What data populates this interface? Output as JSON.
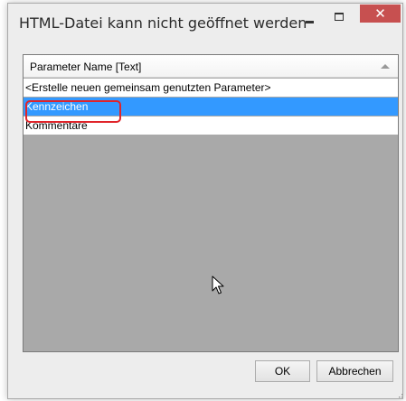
{
  "window": {
    "title": "HTML-Datei kann nicht geöffnet werden",
    "close_glyph": "✕"
  },
  "list": {
    "column_header": "Parameter Name [Text]",
    "items": [
      "<Erstelle neuen gemeinsam genutzten Parameter>",
      "Kennzeichen",
      "Kommentare"
    ],
    "selected_index": 1
  },
  "buttons": {
    "ok": "OK",
    "cancel": "Abbrechen"
  },
  "colors": {
    "selection": "#3399ff",
    "close_button": "#c75050",
    "highlight": "#e0242a",
    "list_background": "#a9a9a9"
  },
  "icons": {
    "cursor": "arrow-cursor-icon",
    "sort": "sort-ascending-icon"
  }
}
